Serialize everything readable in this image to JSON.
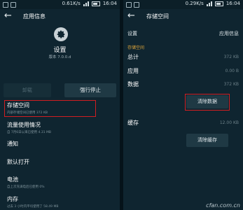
{
  "left": {
    "status": {
      "speed": "0.61K/s",
      "time": "16:04"
    },
    "title": "应用信息",
    "app_name": "设置",
    "app_version": "版本 7.0.0.d",
    "btn_disabled": "卸载",
    "btn_force_stop": "强行停止",
    "items": [
      {
        "title": "存储空间",
        "sub": "内部存储空间已使用 372 KB"
      },
      {
        "title": "流量使用情况",
        "sub": "自 7月6日以来已使用 4.31 MB"
      },
      {
        "title": "通知",
        "sub": ""
      },
      {
        "title": "默认打开",
        "sub": ""
      },
      {
        "title": "电池",
        "sub": "自上次充满电后已使用 0%"
      },
      {
        "title": "内存",
        "sub": "过去 3 小时内平均使用了 58.49 MB"
      }
    ]
  },
  "right": {
    "status": {
      "speed": "0.29K/s",
      "time": "16:04"
    },
    "title": "存储空间",
    "setting_label": "设置",
    "app_info_label": "应用信息",
    "section": "存储空间",
    "rows": [
      {
        "label": "总计",
        "value": "372 KB"
      },
      {
        "label": "应用",
        "value": "0.00 B"
      },
      {
        "label": "数据",
        "value": "372 KB"
      }
    ],
    "clear_data": "清除数据",
    "cache_label": "缓存",
    "cache_value": "12.00 KB",
    "clear_cache": "清除缓存"
  },
  "watermark": "cfan.com.cn",
  "colors": {
    "highlight": "#d11e22",
    "section_accent": "#e0a73a",
    "background": "#0f2530"
  }
}
